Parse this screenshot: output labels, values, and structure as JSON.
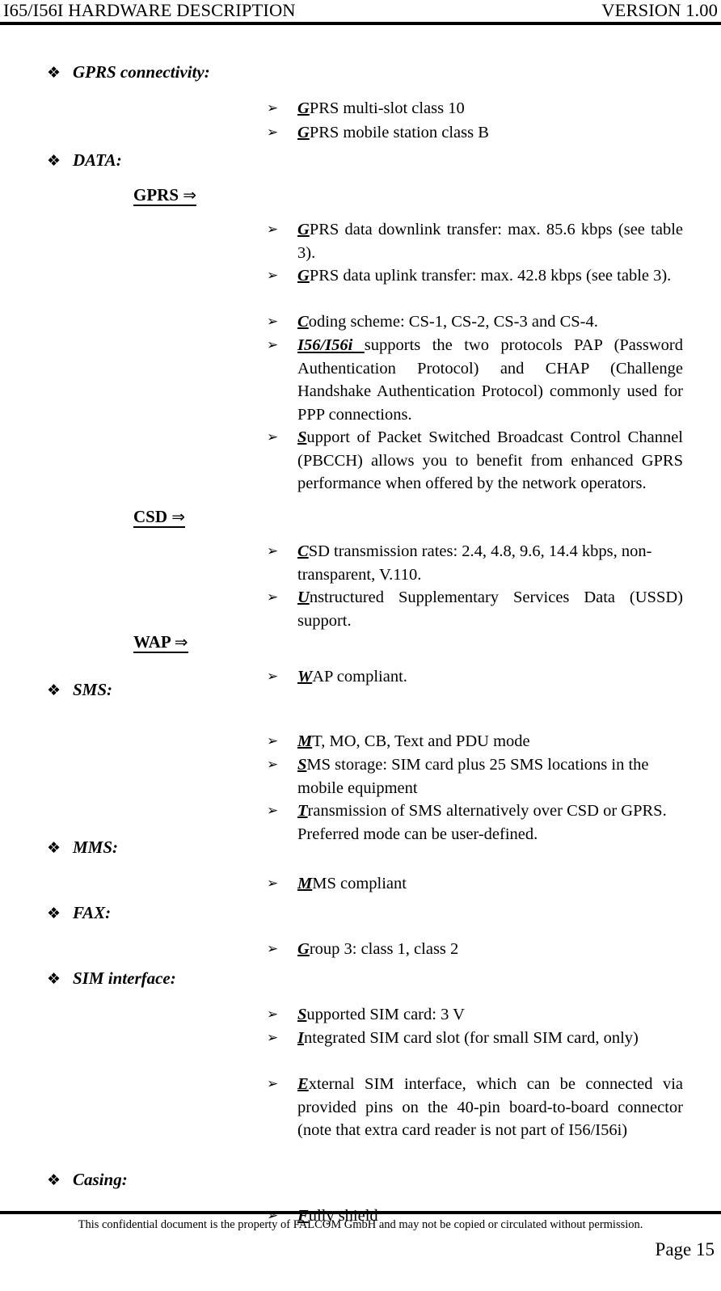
{
  "header": {
    "left_title": "I65/I56I HARDWARE DESCRIPTION",
    "right_title": "VERSION 1.00"
  },
  "sections": [
    {
      "bullet_glyph": "❖",
      "title": "GPRS connectivity:",
      "items": [
        {
          "lead": "G",
          "rest": "PRS multi-slot class 10"
        },
        {
          "lead": "G",
          "rest": "PRS mobile station class B"
        }
      ]
    },
    {
      "bullet_glyph": "❖",
      "title": "DATA:",
      "subheads": [
        {
          "label": "GPRS",
          "arrow": "⇒",
          "items": [
            {
              "lead": "G",
              "rest": "PRS data downlink transfer: max. 85.6 kbps (see table 3)."
            },
            {
              "lead": "G",
              "rest": "PRS data uplink transfer: max. 42.8 kbps (see table 3)."
            },
            {
              "lead": "C",
              "rest": "oding scheme: CS-1, CS-2, CS-3 and CS-4."
            },
            {
              "lead": "I56/I56i ",
              "lead_style": "bold-italic",
              "rest": "supports the two protocols PAP (Password Authentication Protocol) and CHAP (Challenge Handshake Authentication Protocol) commonly used for PPP connections."
            },
            {
              "lead": "S",
              "rest": "upport of Packet Switched Broadcast Control Channel (PBCCH) allows you to benefit from enhanced GPRS performance when offered by the network operators."
            }
          ]
        },
        {
          "label": "CSD",
          "arrow": "⇒",
          "items": [
            {
              "lead": "C",
              "rest": "SD transmission rates: 2.4, 4.8, 9.6, 14.4 kbps, non-transparent, V.110."
            },
            {
              "lead": "U",
              "rest": "nstructured Supplementary Services Data (USSD) support."
            }
          ]
        },
        {
          "label": "WAP",
          "arrow": "⇒",
          "items": [
            {
              "lead": "W",
              "rest": "AP compliant."
            }
          ]
        }
      ]
    },
    {
      "bullet_glyph": "❖",
      "title": "SMS:",
      "items": [
        {
          "lead": "M",
          "rest": "T, MO, CB, Text and PDU mode"
        },
        {
          "lead": "S",
          "rest": "MS storage: SIM card plus 25 SMS locations in the mobile equipment"
        },
        {
          "lead": "T",
          "rest": "ransmission of SMS alternatively over CSD or GPRS. Preferred mode can be user-defined."
        }
      ]
    },
    {
      "bullet_glyph": "❖",
      "title": "MMS:",
      "items": [
        {
          "lead": "M",
          "rest": "MS compliant"
        }
      ]
    },
    {
      "bullet_glyph": "❖",
      "title": "FAX:",
      "items": [
        {
          "lead": "G",
          "rest": "roup 3: class 1, class 2"
        }
      ]
    },
    {
      "bullet_glyph": "❖",
      "title": "SIM interface:",
      "items": [
        {
          "lead": "S",
          "rest": "upported SIM card: 3 V"
        },
        {
          "lead": "I",
          "rest": "ntegrated SIM card slot (for small SIM card, only)"
        },
        {
          "lead": "E",
          "rest": "xternal SIM interface, which can be connected via provided pins on the 40-pin board-to-board connector (note that extra card reader is not part of I56/I56i)"
        }
      ]
    },
    {
      "bullet_glyph": "❖",
      "title": "Casing:",
      "items": [
        {
          "lead": "F",
          "rest": "ully shield"
        }
      ]
    }
  ],
  "list_bullet_glyph": "➢",
  "footer": {
    "confidentiality": "This confidential document is the property of FALCOM GmbH and may not be copied or circulated without permission.",
    "page_label": "Page 15"
  }
}
